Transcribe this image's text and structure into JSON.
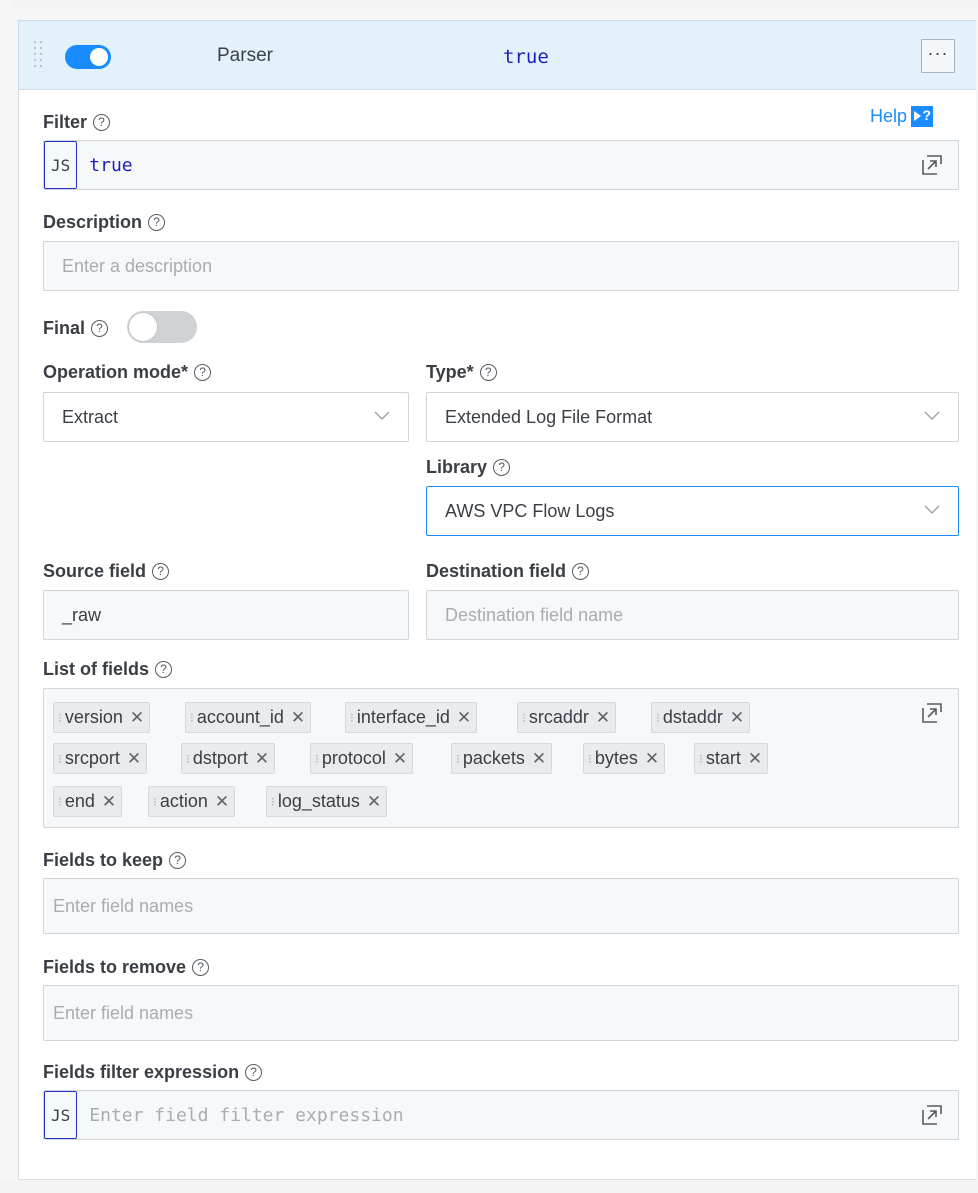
{
  "header": {
    "title": "Parser",
    "filter_value": "true",
    "enabled": true,
    "more_label": "···"
  },
  "help": {
    "label": "Help",
    "icon": "help-panel-icon"
  },
  "filter": {
    "label": "Filter",
    "js_tag": "JS",
    "value": "true"
  },
  "description": {
    "label": "Description",
    "placeholder": "Enter a description",
    "value": ""
  },
  "final": {
    "label": "Final",
    "on": false
  },
  "operation_mode": {
    "label": "Operation mode*",
    "value": "Extract"
  },
  "type": {
    "label": "Type*",
    "value": "Extended Log File Format"
  },
  "library": {
    "label": "Library",
    "value": "AWS VPC Flow Logs"
  },
  "source_field": {
    "label": "Source field",
    "value": "_raw"
  },
  "destination_field": {
    "label": "Destination field",
    "placeholder": "Destination field name",
    "value": ""
  },
  "list_of_fields": {
    "label": "List of fields",
    "tags": [
      "version",
      "account_id",
      "interface_id",
      "srcaddr",
      "dstaddr",
      "srcport",
      "dstport",
      "protocol",
      "packets",
      "bytes",
      "start",
      "end",
      "action",
      "log_status"
    ]
  },
  "fields_to_keep": {
    "label": "Fields to keep",
    "placeholder": "Enter field names"
  },
  "fields_to_remove": {
    "label": "Fields to remove",
    "placeholder": "Enter field names"
  },
  "fields_filter_expression": {
    "label": "Fields filter expression",
    "js_tag": "JS",
    "placeholder": "Enter field filter expression"
  },
  "colors": {
    "accent": "#1a8cff",
    "header_bg": "#e3f1fb",
    "code": "#1b1fbd"
  }
}
